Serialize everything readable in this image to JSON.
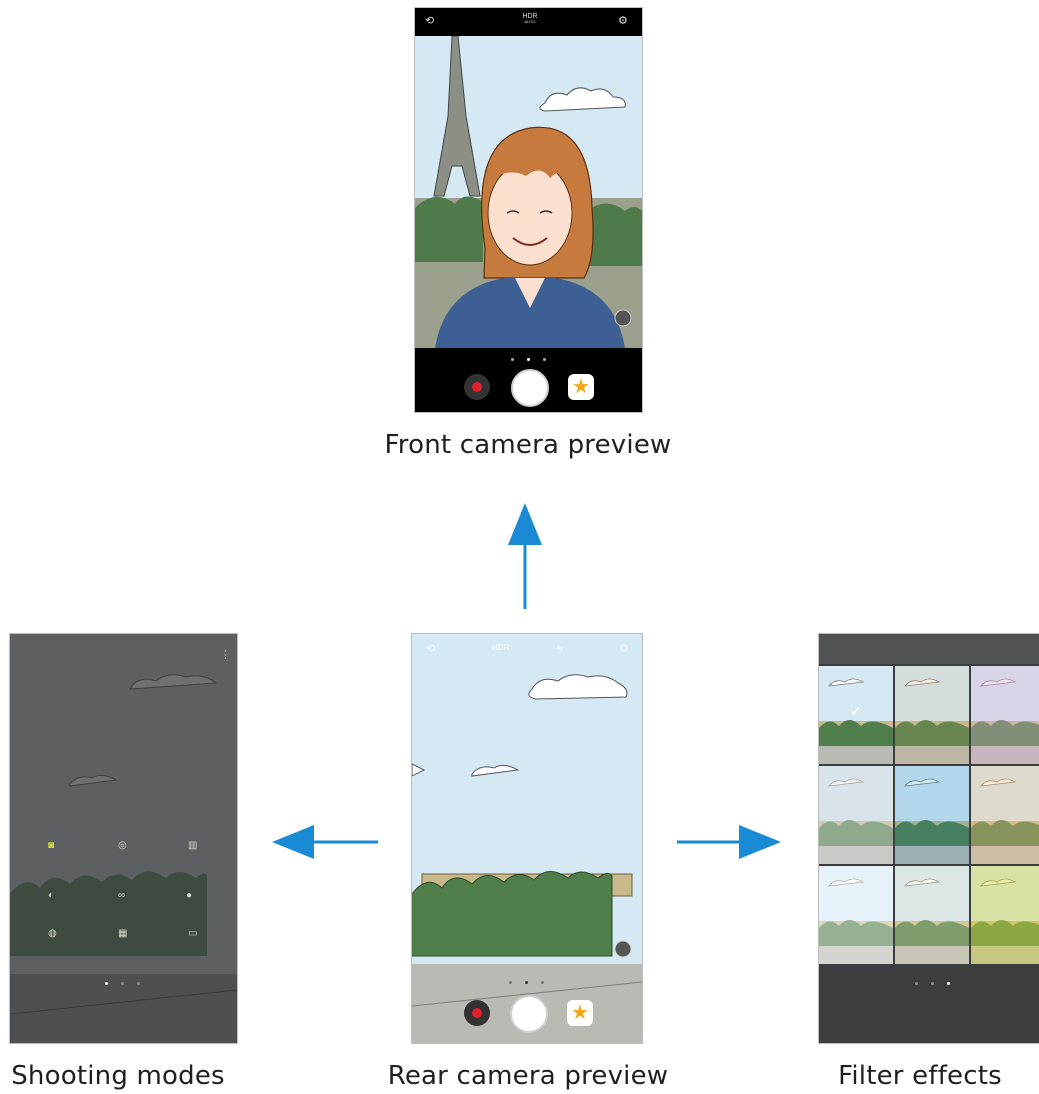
{
  "captions": {
    "front": "Front camera preview",
    "rear": "Rear camera preview",
    "modes": "Shooting modes",
    "filters": "Filter effects"
  },
  "front_phone": {
    "topbar": {
      "hdr_label": "HDR",
      "hdr_sub": "AUTO",
      "left_icon": "switch-camera-icon",
      "right_icon": "settings-gear-icon"
    }
  },
  "colors": {
    "arrow": "#1a8ad4",
    "sky": "#d5e9f5",
    "record": "#e0202a",
    "star": "#f2a618",
    "modes_overlay": "#55595a"
  },
  "icons": [
    "switch-camera-icon",
    "settings-gear-icon",
    "record-icon",
    "shutter-icon",
    "sticker-star-icon",
    "rotate-icon",
    "more-options-icon"
  ]
}
